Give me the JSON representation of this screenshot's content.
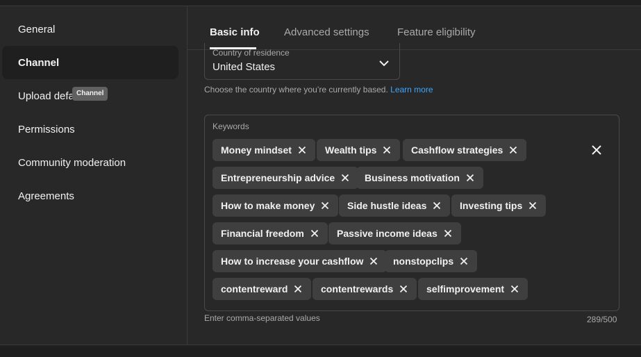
{
  "sidebar": {
    "items": [
      {
        "label": "General"
      },
      {
        "label": "Channel"
      },
      {
        "label": "Upload defa"
      },
      {
        "label": "Permissions"
      },
      {
        "label": "Community moderation"
      },
      {
        "label": "Agreements"
      }
    ],
    "active": "Channel",
    "tooltip": "Channel"
  },
  "tabs": [
    {
      "label": "Basic info",
      "active": true
    },
    {
      "label": "Advanced settings",
      "active": false
    },
    {
      "label": "Feature eligibility",
      "active": false
    }
  ],
  "country": {
    "label": "Country of residence",
    "value": "United States",
    "help_text": "Choose the country where you’re currently based.",
    "help_link": "Learn more"
  },
  "keywords": {
    "label": "Keywords",
    "tags": [
      "Money mindset",
      "Wealth tips",
      "Cashflow strategies",
      "Entrepreneurship advice",
      "Business motivation",
      "How to make money",
      "Side hustle ideas",
      "Investing tips",
      "Financial freedom",
      "Passive income ideas",
      "How to increase your cashflow",
      "nonstopclips",
      "contentreward",
      "contentrewards",
      "selfimprovement"
    ],
    "footnote": "Enter comma-separated values",
    "counter": "289/500"
  },
  "icons": {
    "chip_remove": "close-icon",
    "clear_all": "close-icon",
    "dropdown": "chevron-down-icon"
  }
}
